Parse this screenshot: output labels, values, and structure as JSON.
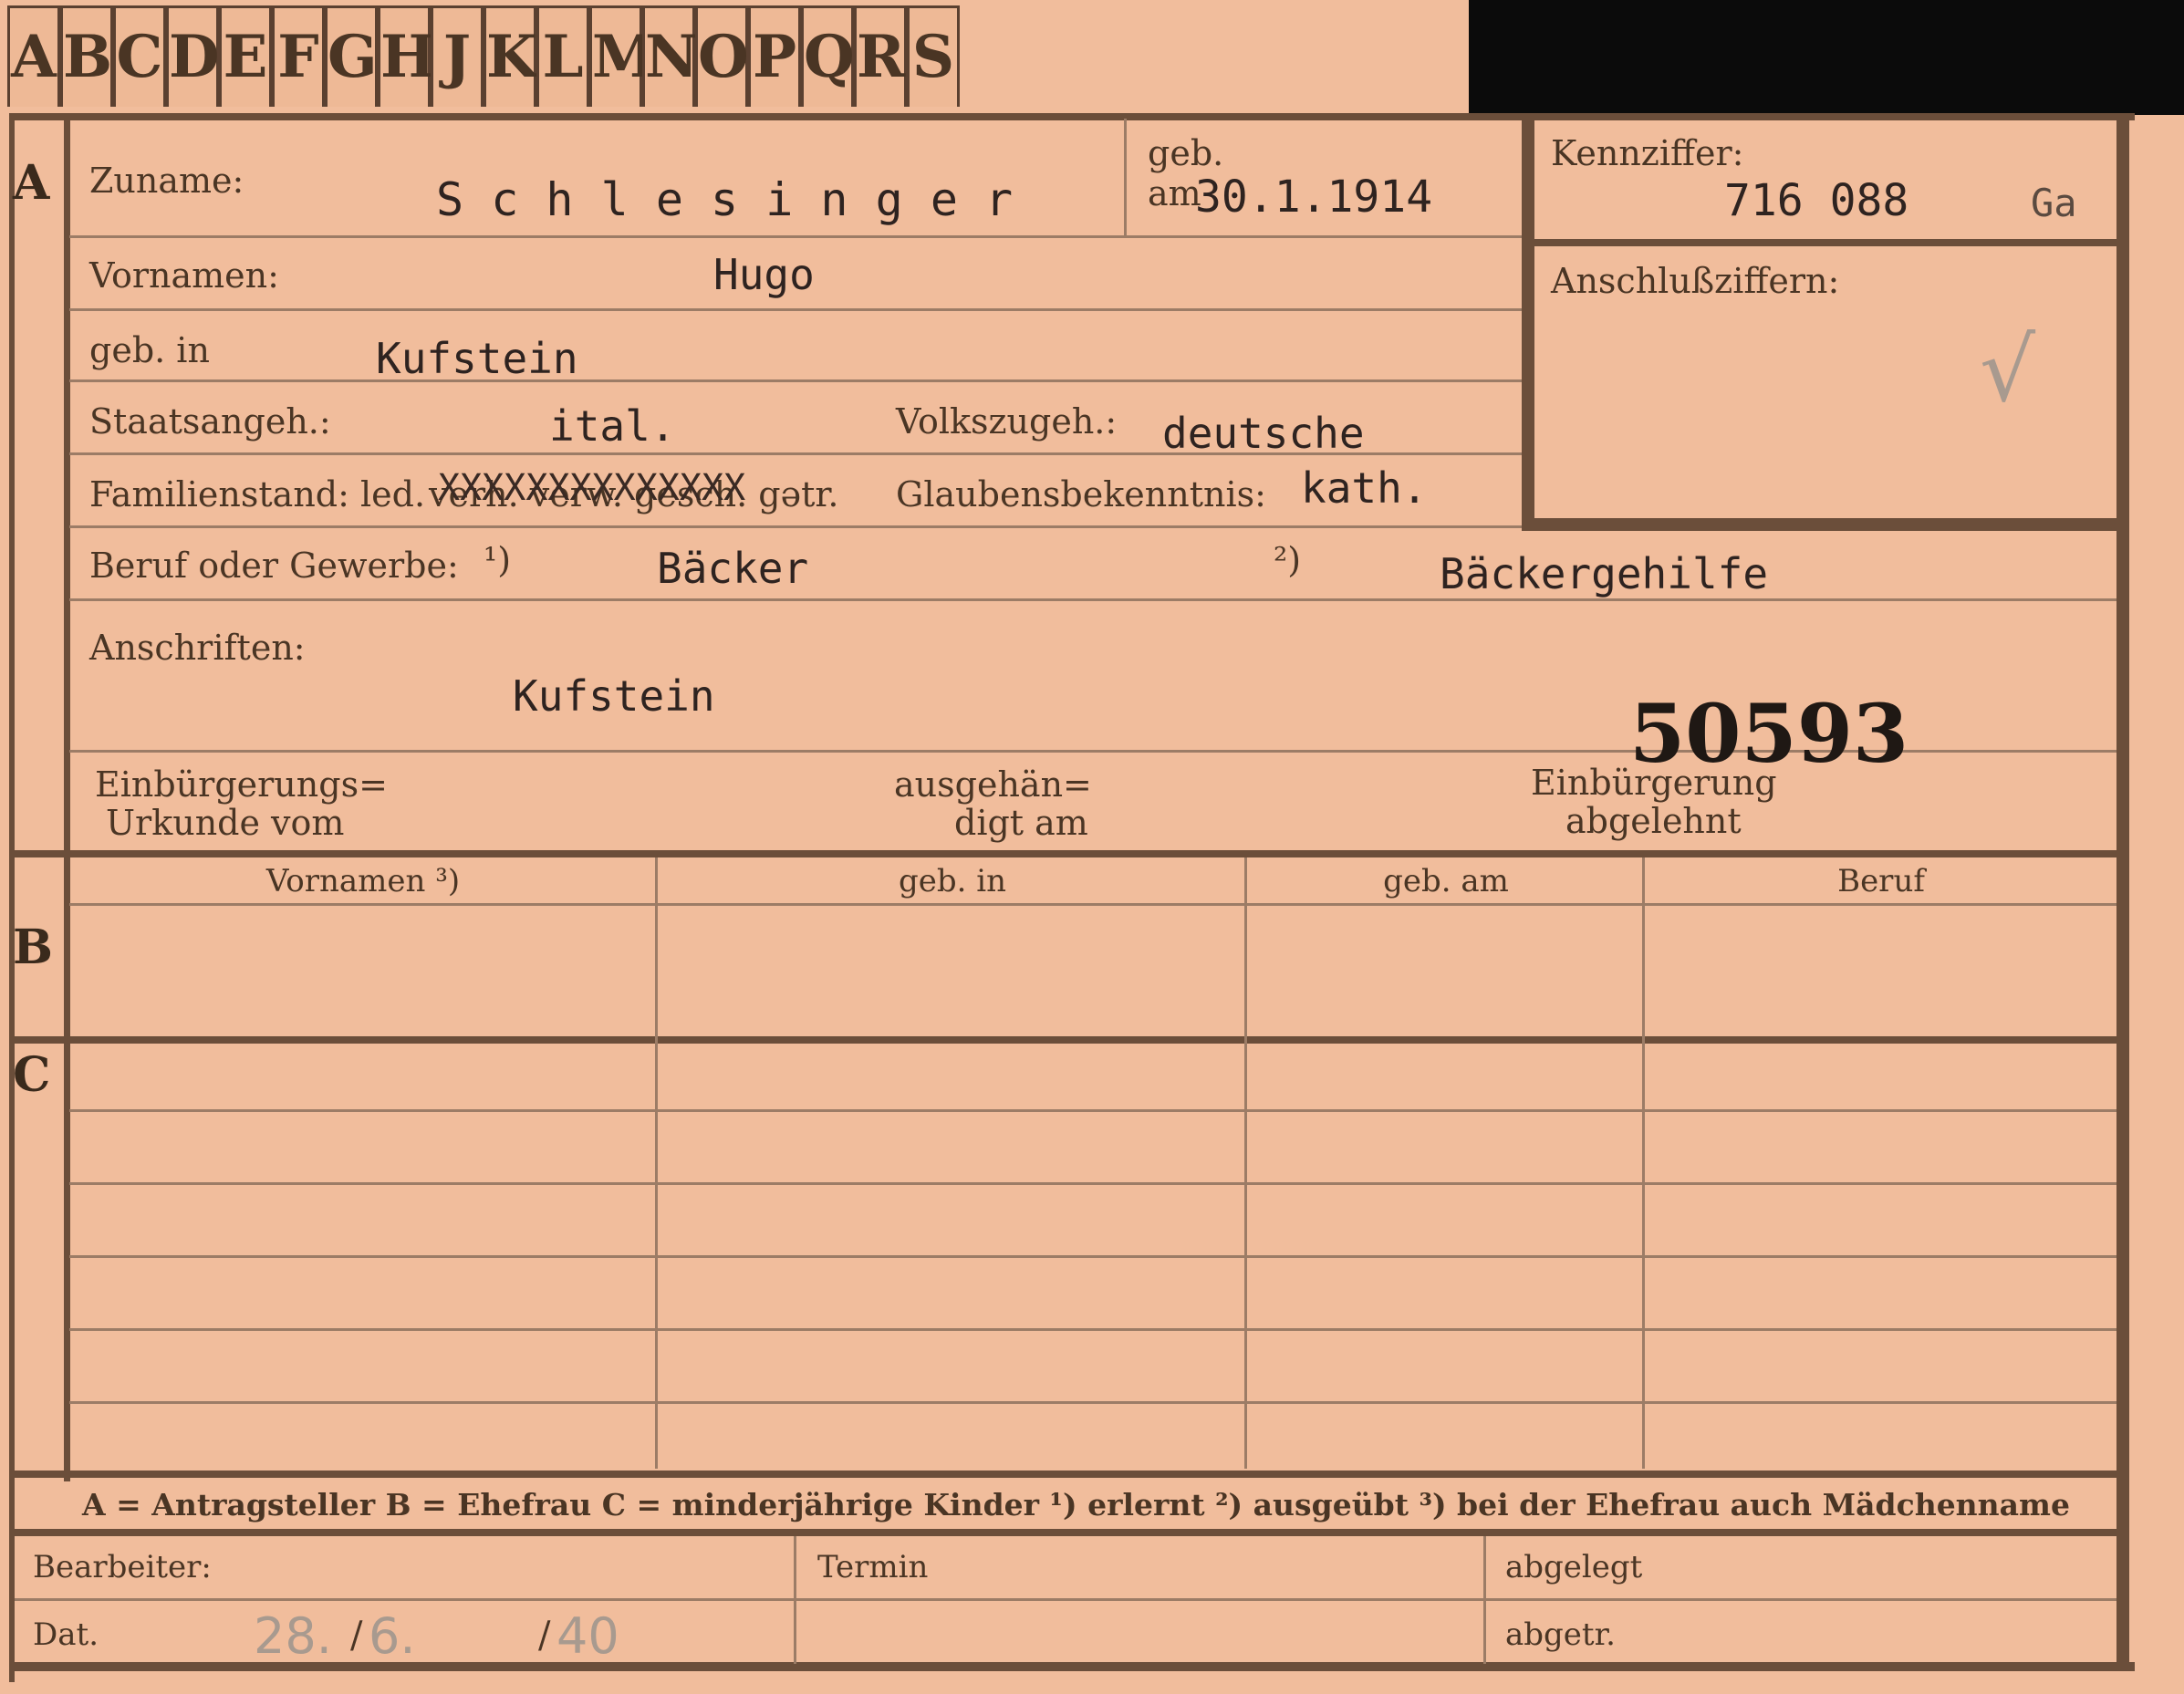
{
  "tabs": [
    "A",
    "B",
    "C",
    "D",
    "E",
    "F",
    "G",
    "H",
    "J",
    "K",
    "L",
    "M",
    "N",
    "O",
    "P",
    "Q",
    "R",
    "S"
  ],
  "sections": {
    "a": "A",
    "b": "B",
    "c": "C"
  },
  "labels": {
    "zuname": "Zuname:",
    "geb_am_line1": "geb.",
    "geb_am_line2": "am",
    "kennziffer": "Kennziffer:",
    "anschluss": "Anschlußziffern:",
    "vornamen": "Vornamen:",
    "geb_in": "geb. in",
    "staatsangeh": "Staatsangeh.:",
    "volkszugeh": "Volkszugeh.:",
    "familienstand": "Familienstand: led.",
    "familienstand_struck": "verh. verw. gesch. gətr.",
    "glaube": "Glaubensbekenntnis:",
    "beruf": "Beruf oder Gewerbe:",
    "beruf_note1": "¹)",
    "beruf_note2": "²)",
    "anschriften": "Anschriften:",
    "einb_urkunde_1": "Einbürgerungs=",
    "einb_urkunde_2": "Urkunde vom",
    "ausgehaen_1": "ausgehän=",
    "ausgehaen_2": "digt am",
    "einb_abgelehnt_1": "Einbürgerung",
    "einb_abgelehnt_2": "abgelehnt"
  },
  "values": {
    "zuname": "S c h l e s i n g e r",
    "geb_am": "30.1.1914",
    "kennziffer": "716 088",
    "kennziffer_suffix": "Ga",
    "vornamen": "Hugo",
    "geb_in": "Kufstein",
    "staatsangeh": "ital.",
    "volkszugeh": "deutsche",
    "strikeout": "XXXXXXXXXXXXXX",
    "glaube": "kath.",
    "beruf_erlernt": "Bäcker",
    "beruf_ausgeuebt": "Bäckergehilfe",
    "anschrift": "Kufstein",
    "stamp_number": "50593",
    "checkmark": "√"
  },
  "table_headers": [
    "Vornamen ³)",
    "geb. in",
    "geb. am",
    "Beruf"
  ],
  "legend": "A = Antragsteller   B = Ehefrau   C = minderjährige Kinder   ¹) erlernt   ²) ausgeübt   ³) bei der Ehefrau auch Mädchenname",
  "footer": {
    "bearbeiter": "Bearbeiter:",
    "termin": "Termin",
    "abgelegt": "abgelegt",
    "dat": "Dat.",
    "abgetr": "abgetr.",
    "date_day": "28.",
    "date_month": "6.",
    "date_year": "40",
    "slash": "/"
  },
  "colors": {
    "card": "#f1bd9c",
    "ink": "#4a3524",
    "rule": "#6b4e3a"
  }
}
